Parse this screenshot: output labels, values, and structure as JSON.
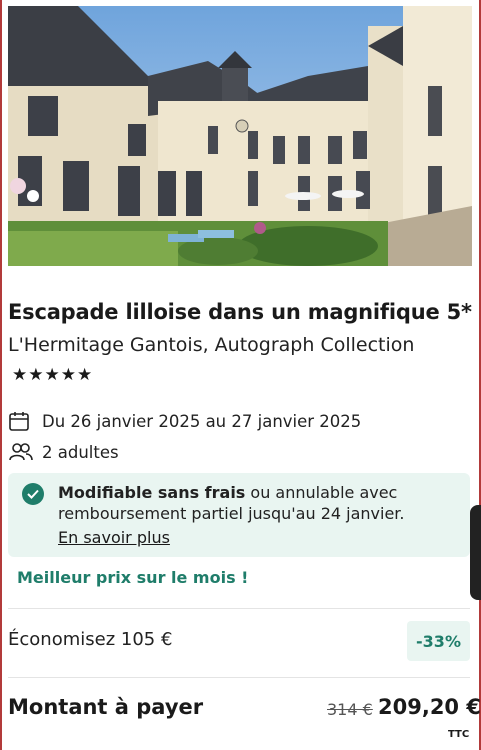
{
  "listing": {
    "title": "Escapade lilloise dans un magnifique 5*",
    "hotel_name": "L'Hermitage Gantois, Autograph Collection",
    "stars": "★★★★★",
    "star_rating": 5
  },
  "stay": {
    "dates": "Du 26 janvier 2025 au 27 janvier 2025",
    "guests": "2 adultes"
  },
  "cancellation": {
    "bold": "Modifiable sans frais",
    "rest": " ou annulable avec remboursement partiel jusqu'au 24 janvier.",
    "link": "En savoir plus"
  },
  "promo": {
    "best_price": "Meilleur prix sur le mois !"
  },
  "savings": {
    "label": "Économisez 105 €",
    "badge": "-33%"
  },
  "total": {
    "label": "Montant à payer",
    "old_price": "314 €",
    "price": "209,20 €",
    "tax_note": "TTC"
  },
  "colors": {
    "accent": "#1f7d6a",
    "notice_bg": "#e9f5f1"
  },
  "icons": {
    "calendar": "calendar-icon",
    "guests": "users-icon",
    "check": "check-circle-icon"
  }
}
